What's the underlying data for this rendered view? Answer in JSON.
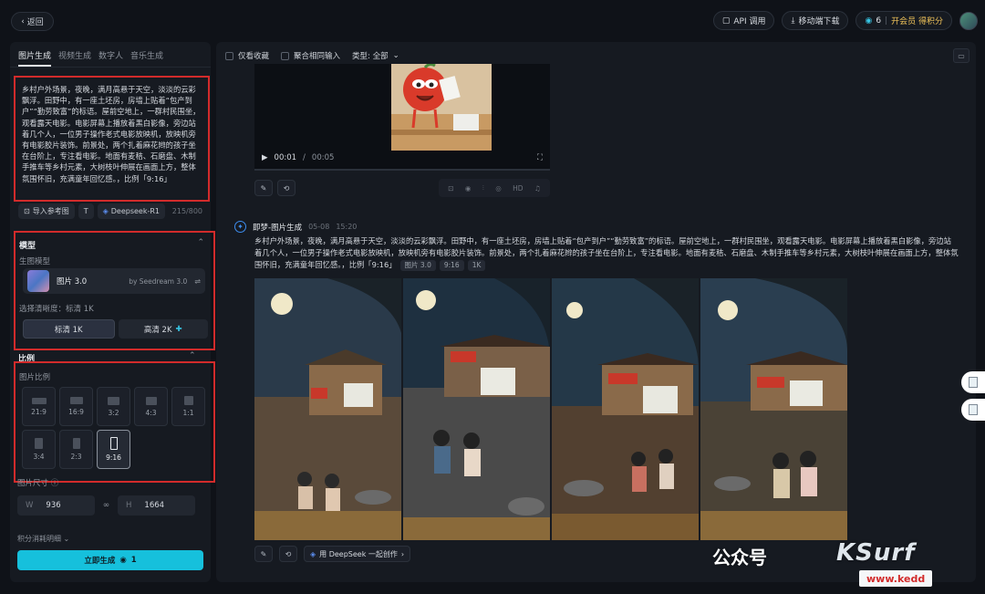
{
  "topbar": {
    "back_label": "返回",
    "api_label": "API 调用",
    "mobile_label": "移动端下载",
    "points_count": "6",
    "vip_label": "开会员 得积分"
  },
  "sidebar": {
    "tabs": [
      "图片生成",
      "视频生成",
      "数字人",
      "音乐生成"
    ],
    "prompt_text": "乡村户外场景，夜晚，满月高悬于天空，淡淡的云彩飘浮。田野中，有一座土坯房，房墙上贴着“包产到户”“勤劳致富”的标语。屋前空地上，一群村民围坐，观看露天电影。电影屏幕上播放着黑白影像，旁边站着几个人，一位男子操作老式电影放映机，放映机旁有电影胶片装饰。前景处，两个扎着麻花辫的孩子坐在台阶上，专注看电影。地面有麦秸、石磨盘、木制手推车等乡村元素，大树枝叶伸展在画面上方，整体氛围怀旧，充满童年回忆感。，比例「9:16」",
    "ref_image_label": "导入参考图",
    "deepseek_label": "Deepseek-R1",
    "char_count": "215/800",
    "model_section_title": "模型",
    "gen_model_label": "生图模型",
    "model_name": "图片 3.0",
    "model_by": "by Seedream 3.0",
    "resolution_label": "选择清晰度：标清 1K",
    "res_standard": "标清 1K",
    "res_hd": "高清 2K",
    "ratio_section_title": "比例",
    "ratio_label": "图片比例",
    "ratios": [
      "21:9",
      "16:9",
      "3:2",
      "4:3",
      "1:1",
      "3:4",
      "2:3",
      "9:16"
    ],
    "size_label": "图片尺寸",
    "width_key": "W",
    "width_value": "936",
    "height_key": "H",
    "height_value": "1664",
    "credits_label": "积分消耗明细",
    "generate_label": "立即生成",
    "generate_cost": "1"
  },
  "main": {
    "filter_favorites": "仅看收藏",
    "filter_aggregate": "聚合相同输入",
    "filter_type": "类型: 全部",
    "video_time": "00:01",
    "video_duration": "00:05",
    "hd_label": "HD",
    "message": {
      "author": "即梦-图片生成",
      "date": "05-08",
      "time": "15:20",
      "text": "乡村户外场景，夜晚，满月高悬于天空，淡淡的云彩飘浮。田野中，有一座土坯房，房墙上贴着“包产到户”“勤劳致富”的标语。屋前空地上，一群村民围坐，观看露天电影。电影屏幕上播放着黑白影像，旁边站着几个人，一位男子操作老式电影放映机，放映机旁有电影胶片装饰。前景处，两个扎着麻花辫的孩子坐在台阶上，专注看电影。地面有麦秸、石磨盘、木制手推车等乡村元素，大树枝叶伸展在画面上方，整体氛围怀旧，充满童年回忆感。，比例「9:16」",
      "tags": [
        "图片 3.0",
        "9:16",
        "1K"
      ]
    },
    "deepseek_create": "用 DeepSeek 一起创作"
  },
  "watermark": {
    "text": "公众号",
    "brand": "KSurf",
    "url": "www.kedd"
  },
  "colors": {
    "accent": "#16c0dc",
    "highlight_box": "#d22b2b",
    "background": "#0f1218",
    "panel": "#161a21"
  }
}
